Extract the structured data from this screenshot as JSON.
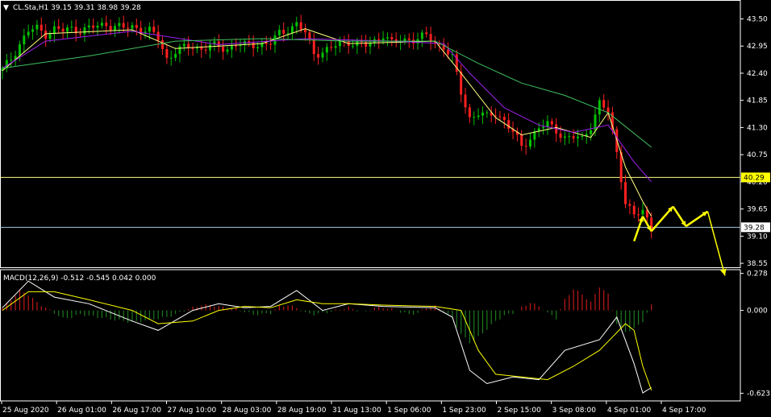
{
  "header": {
    "menu_glyph": "▼",
    "title": "CL.Sta,H1  39.15 39.31 38.98 39.28"
  },
  "macd": {
    "label": "MACD(12,26,9) -0.512 -0.545 0.042 0.000"
  },
  "colors": {
    "background": "#000000",
    "bull_candle": "#00c000",
    "bear_candle": "#ff2020",
    "ma_fast": "#ffff80",
    "ma_mid": "#a020f0",
    "ma_slow": "#40c060",
    "hist_pos": "#c01818",
    "hist_neg": "#1d7a1d",
    "macd_line": "#ffffff",
    "signal_line": "#ffff00",
    "level_40_29": "#ffff80",
    "level_39_28": "#a0c8e0",
    "forecast": "#ffff00",
    "axis": "#ffffff"
  },
  "chart_data": [
    {
      "type": "candlestick",
      "symbol": "CL.Sta",
      "timeframe": "H1",
      "ohlc_last": {
        "open": 39.15,
        "high": 39.31,
        "low": 38.98,
        "close": 39.28
      },
      "y_ticks": [
        43.5,
        42.95,
        42.4,
        41.85,
        41.3,
        40.75,
        40.2,
        39.65,
        39.1,
        38.55
      ],
      "ylim": [
        38.47,
        43.85
      ],
      "x_labels": [
        "25 Aug 2020",
        "26 Aug 01:00",
        "26 Aug 17:00",
        "27 Aug 10:00",
        "28 Aug 03:00",
        "28 Aug 19:00",
        "31 Aug 13:00",
        "1 Sep 06:00",
        "1 Sep 23:00",
        "2 Sep 15:00",
        "3 Sep 08:00",
        "4 Sep 01:00",
        "4 Sep 17:00"
      ],
      "close_path": [
        [
          0,
          42.45
        ],
        [
          2,
          42.7
        ],
        [
          4,
          43.0
        ],
        [
          6,
          43.25
        ],
        [
          8,
          43.3
        ],
        [
          10,
          43.2
        ],
        [
          12,
          43.3
        ],
        [
          14,
          43.25
        ],
        [
          16,
          43.3
        ],
        [
          18,
          43.28
        ],
        [
          20,
          43.3
        ],
        [
          22,
          43.35
        ],
        [
          24,
          43.4
        ],
        [
          26,
          43.35
        ],
        [
          28,
          43.3
        ],
        [
          30,
          43.35
        ],
        [
          32,
          43.3
        ],
        [
          34,
          43.25
        ],
        [
          36,
          43.1
        ],
        [
          38,
          42.7
        ],
        [
          40,
          42.85
        ],
        [
          42,
          42.9
        ],
        [
          44,
          42.95
        ],
        [
          46,
          42.9
        ],
        [
          48,
          42.95
        ],
        [
          50,
          42.92
        ],
        [
          52,
          42.9
        ],
        [
          54,
          43.0
        ],
        [
          56,
          42.95
        ],
        [
          58,
          42.98
        ],
        [
          60,
          43.0
        ],
        [
          62,
          43.0
        ],
        [
          64,
          43.2
        ],
        [
          66,
          43.3
        ],
        [
          68,
          43.4
        ],
        [
          70,
          43.2
        ],
        [
          72,
          42.8
        ],
        [
          74,
          42.85
        ],
        [
          76,
          42.9
        ],
        [
          78,
          43.0
        ],
        [
          80,
          43.05
        ],
        [
          82,
          43.0
        ],
        [
          84,
          42.95
        ],
        [
          86,
          43.05
        ],
        [
          88,
          43.2
        ],
        [
          90,
          43.0
        ],
        [
          92,
          43.05
        ],
        [
          94,
          43.1
        ],
        [
          96,
          43.1
        ],
        [
          98,
          43.15
        ],
        [
          100,
          43.0
        ],
        [
          102,
          42.95
        ],
        [
          104,
          42.7
        ],
        [
          106,
          42.0
        ],
        [
          108,
          41.5
        ],
        [
          110,
          41.6
        ],
        [
          112,
          41.5
        ],
        [
          114,
          41.6
        ],
        [
          116,
          41.45
        ],
        [
          118,
          41.2
        ],
        [
          120,
          40.9
        ],
        [
          122,
          41.1
        ],
        [
          124,
          41.3
        ],
        [
          126,
          41.35
        ],
        [
          128,
          41.25
        ],
        [
          130,
          41.1
        ],
        [
          132,
          41.1
        ],
        [
          134,
          41.05
        ],
        [
          136,
          41.35
        ],
        [
          138,
          41.8
        ],
        [
          140,
          41.6
        ],
        [
          142,
          40.8
        ],
        [
          144,
          39.8
        ],
        [
          146,
          39.5
        ],
        [
          148,
          39.6
        ],
        [
          150,
          39.3
        ]
      ],
      "moving_averages": [
        {
          "id": "ma_fast",
          "points": [
            [
              0,
              42.45
            ],
            [
              10,
              43.2
            ],
            [
              30,
              43.28
            ],
            [
              40,
              42.9
            ],
            [
              60,
              43.0
            ],
            [
              70,
              43.3
            ],
            [
              80,
              43.0
            ],
            [
              100,
              43.05
            ],
            [
              106,
              42.4
            ],
            [
              114,
              41.5
            ],
            [
              120,
              41.15
            ],
            [
              128,
              41.3
            ],
            [
              136,
              41.1
            ],
            [
              140,
              41.6
            ],
            [
              144,
              40.5
            ],
            [
              148,
              39.8
            ],
            [
              150,
              39.5
            ]
          ]
        },
        {
          "id": "ma_mid",
          "points": [
            [
              0,
              42.5
            ],
            [
              10,
              43.05
            ],
            [
              30,
              43.25
            ],
            [
              50,
              42.98
            ],
            [
              70,
              43.1
            ],
            [
              90,
              43.05
            ],
            [
              102,
              43.0
            ],
            [
              108,
              42.4
            ],
            [
              116,
              41.7
            ],
            [
              124,
              41.35
            ],
            [
              132,
              41.2
            ],
            [
              140,
              41.35
            ],
            [
              146,
              40.6
            ],
            [
              150,
              40.2
            ]
          ]
        },
        {
          "id": "ma_slow",
          "points": [
            [
              0,
              42.5
            ],
            [
              20,
              42.75
            ],
            [
              40,
              43.05
            ],
            [
              60,
              43.1
            ],
            [
              80,
              43.05
            ],
            [
              100,
              43.05
            ],
            [
              110,
              42.6
            ],
            [
              120,
              42.2
            ],
            [
              130,
              41.95
            ],
            [
              140,
              41.6
            ],
            [
              150,
              40.9
            ]
          ]
        }
      ],
      "levels": [
        {
          "value": 40.29,
          "label": "40.29"
        },
        {
          "value": 39.28,
          "label": "39.28"
        }
      ],
      "forecast_path": [
        [
          146,
          39.0
        ],
        [
          148,
          39.5
        ],
        [
          150,
          39.2
        ],
        [
          155,
          39.7
        ],
        [
          158,
          39.3
        ],
        [
          163,
          39.6
        ],
        [
          167,
          38.3
        ]
      ]
    },
    {
      "type": "macd",
      "params": "12,26,9",
      "values": {
        "macd": -0.512,
        "signal": -0.545,
        "hist_a": 0.042,
        "hist_b": 0.0
      },
      "y_ticks": [
        0.278,
        0.0,
        -0.623
      ],
      "ylim": [
        -0.68,
        0.3
      ],
      "histogram": [
        [
          0,
          0.02
        ],
        [
          2,
          0.08
        ],
        [
          4,
          0.15
        ],
        [
          6,
          0.12
        ],
        [
          8,
          0.06
        ],
        [
          10,
          0.02
        ],
        [
          12,
          -0.02
        ],
        [
          14,
          -0.06
        ],
        [
          16,
          -0.05
        ],
        [
          18,
          -0.03
        ],
        [
          20,
          -0.04
        ],
        [
          22,
          -0.05
        ],
        [
          24,
          -0.06
        ],
        [
          26,
          -0.07
        ],
        [
          28,
          -0.08
        ],
        [
          30,
          -0.09
        ],
        [
          32,
          -0.08
        ],
        [
          34,
          -0.07
        ],
        [
          36,
          -0.06
        ],
        [
          38,
          -0.05
        ],
        [
          40,
          -0.03
        ],
        [
          42,
          0.0
        ],
        [
          44,
          0.02
        ],
        [
          46,
          0.04
        ],
        [
          48,
          0.04
        ],
        [
          50,
          0.03
        ],
        [
          52,
          0.02
        ],
        [
          54,
          0.01
        ],
        [
          56,
          -0.01
        ],
        [
          58,
          -0.03
        ],
        [
          60,
          -0.03
        ],
        [
          62,
          -0.02
        ],
        [
          64,
          0.03
        ],
        [
          66,
          0.04
        ],
        [
          68,
          0.02
        ],
        [
          70,
          -0.02
        ],
        [
          72,
          -0.03
        ],
        [
          74,
          -0.02
        ],
        [
          76,
          -0.01
        ],
        [
          78,
          0.01
        ],
        [
          80,
          0.02
        ],
        [
          82,
          0.0
        ],
        [
          84,
          -0.01
        ],
        [
          86,
          0.02
        ],
        [
          88,
          0.02
        ],
        [
          90,
          0.01
        ],
        [
          92,
          -0.01
        ],
        [
          94,
          -0.03
        ],
        [
          96,
          -0.02
        ],
        [
          98,
          0.02
        ],
        [
          100,
          0.03
        ],
        [
          102,
          0.0
        ],
        [
          104,
          -0.06
        ],
        [
          106,
          -0.18
        ],
        [
          108,
          -0.24
        ],
        [
          110,
          -0.2
        ],
        [
          112,
          -0.14
        ],
        [
          114,
          -0.08
        ],
        [
          116,
          -0.04
        ],
        [
          118,
          -0.02
        ],
        [
          120,
          0.02
        ],
        [
          122,
          0.06
        ],
        [
          124,
          0.03
        ],
        [
          126,
          -0.02
        ],
        [
          128,
          -0.06
        ],
        [
          130,
          0.08
        ],
        [
          132,
          0.16
        ],
        [
          134,
          0.12
        ],
        [
          136,
          0.06
        ],
        [
          138,
          0.18
        ],
        [
          140,
          0.12
        ],
        [
          142,
          -0.1
        ],
        [
          144,
          -0.16
        ],
        [
          146,
          -0.14
        ],
        [
          148,
          -0.08
        ],
        [
          150,
          0.04
        ]
      ],
      "macd_line": [
        [
          0,
          0.02
        ],
        [
          6,
          0.22
        ],
        [
          12,
          0.1
        ],
        [
          20,
          0.05
        ],
        [
          30,
          -0.08
        ],
        [
          36,
          -0.15
        ],
        [
          44,
          0.0
        ],
        [
          50,
          0.05
        ],
        [
          56,
          0.02
        ],
        [
          62,
          0.03
        ],
        [
          68,
          0.15
        ],
        [
          74,
          0.0
        ],
        [
          80,
          0.05
        ],
        [
          88,
          0.03
        ],
        [
          100,
          0.02
        ],
        [
          104,
          -0.05
        ],
        [
          108,
          -0.45
        ],
        [
          112,
          -0.55
        ],
        [
          118,
          -0.5
        ],
        [
          124,
          -0.52
        ],
        [
          130,
          -0.3
        ],
        [
          138,
          -0.22
        ],
        [
          142,
          -0.05
        ],
        [
          146,
          -0.4
        ],
        [
          148,
          -0.62
        ],
        [
          150,
          -0.58
        ]
      ],
      "signal_line": [
        [
          0,
          0.0
        ],
        [
          6,
          0.14
        ],
        [
          12,
          0.14
        ],
        [
          20,
          0.08
        ],
        [
          30,
          0.0
        ],
        [
          36,
          -0.1
        ],
        [
          44,
          -0.08
        ],
        [
          50,
          0.0
        ],
        [
          56,
          0.03
        ],
        [
          62,
          0.02
        ],
        [
          68,
          0.08
        ],
        [
          74,
          0.05
        ],
        [
          80,
          0.05
        ],
        [
          88,
          0.04
        ],
        [
          100,
          0.03
        ],
        [
          106,
          0.0
        ],
        [
          110,
          -0.3
        ],
        [
          114,
          -0.48
        ],
        [
          120,
          -0.5
        ],
        [
          126,
          -0.52
        ],
        [
          132,
          -0.42
        ],
        [
          138,
          -0.3
        ],
        [
          144,
          -0.1
        ],
        [
          146,
          -0.15
        ],
        [
          148,
          -0.42
        ],
        [
          150,
          -0.6
        ]
      ]
    }
  ]
}
